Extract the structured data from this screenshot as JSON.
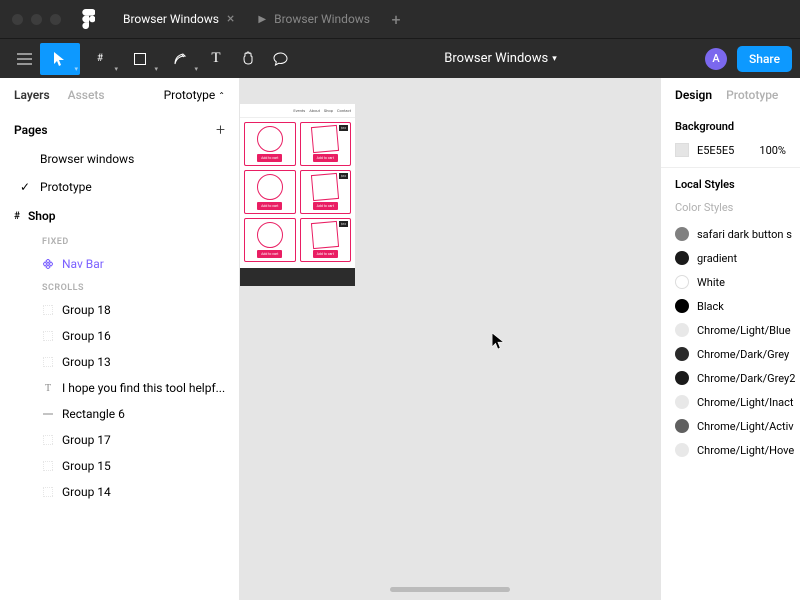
{
  "tabs": {
    "active": "Browser Windows",
    "inactive": "Browser Windows"
  },
  "docTitle": "Browser Windows",
  "avatar": "A",
  "shareLabel": "Share",
  "leftTabs": {
    "layers": "Layers",
    "assets": "Assets",
    "prototype": "Prototype"
  },
  "pagesHeader": "Pages",
  "pages": [
    "Browser windows",
    "Prototype"
  ],
  "topLayer": "Shop",
  "sections": {
    "fixed": "FIXED",
    "scrolls": "SCROLLS"
  },
  "navBar": "Nav Bar",
  "layers": [
    "Group 18",
    "Group 16",
    "Group 13",
    "I hope you find this tool helpf...",
    "Rectangle 6",
    "Group 17",
    "Group 15",
    "Group 14"
  ],
  "frameNav": [
    "Events",
    "About",
    "Shop",
    "Contact"
  ],
  "cardBadge": "$12",
  "addToCart": "Add to cart",
  "rightTabs": {
    "design": "Design",
    "prototype": "Prototype"
  },
  "bgLabel": "Background",
  "bgHex": "E5E5E5",
  "bgOpacity": "100%",
  "localStyles": "Local Styles",
  "colorStyles": "Color Styles",
  "styles": [
    {
      "name": "safari dark button s",
      "color": "#808080"
    },
    {
      "name": "gradient",
      "color": "#1a1a1a"
    },
    {
      "name": "White",
      "color": "#ffffff"
    },
    {
      "name": "Black",
      "color": "#000000"
    },
    {
      "name": "Chrome/Light/Blue",
      "color": "#e8e8e8"
    },
    {
      "name": "Chrome/Dark/Grey",
      "color": "#2a2a2a"
    },
    {
      "name": "Chrome/Dark/Grey2",
      "color": "#1a1a1a"
    },
    {
      "name": "Chrome/Light/Inact",
      "color": "#e8e8e8"
    },
    {
      "name": "Chrome/Light/Activ",
      "color": "#606060"
    },
    {
      "name": "Chrome/Light/Hove",
      "color": "#e8e8e8"
    }
  ]
}
